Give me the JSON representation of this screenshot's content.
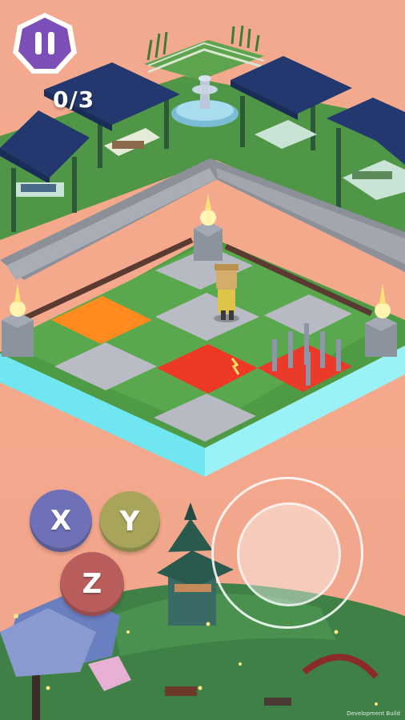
{
  "hud": {
    "score": "0/3",
    "pause_icon": "pause-icon",
    "colors": {
      "pause_fill": "#7c4fb8",
      "pause_border": "#ffffff"
    }
  },
  "controls": {
    "x_label": "X",
    "y_label": "Y",
    "z_label": "Z",
    "colors": {
      "x": "#6f71b8",
      "y": "#a8a55a",
      "z": "#b95e5c"
    }
  },
  "joystick": {
    "icon": "virtual-joystick"
  },
  "footer": {
    "build_label": "Development Build"
  },
  "scene": {
    "colors": {
      "background": "#f3a98d",
      "grass": "#4e9a45",
      "stone_path": "#8a8f99",
      "cyan_edge": "#6fe6f0",
      "tile_orange": "#ff8a1e",
      "tile_red": "#ee3a24",
      "roof": "#22386e"
    }
  }
}
